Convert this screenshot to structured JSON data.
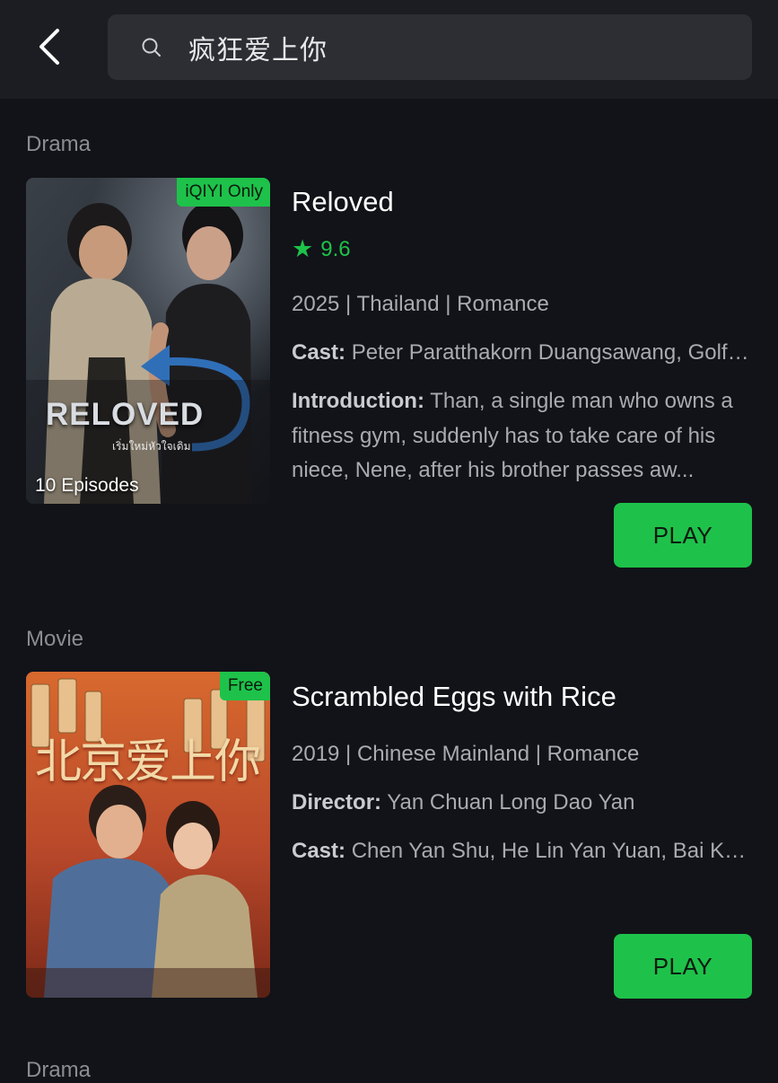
{
  "search": {
    "query": "疯狂爱上你"
  },
  "results": [
    {
      "category": "Drama",
      "badge": "iQIYI Only",
      "episodes": "10 Episodes",
      "poster_text": "RELOVED",
      "poster_subtitle": "เริ่มใหม่หัวใจเดิม",
      "title": "Reloved",
      "rating": "9.6",
      "meta": "2025 | Thailand | Romance",
      "cast_label": "Cast:",
      "cast": "Peter Paratthakorn Duangsawang, Golf K...",
      "intro_label": "Introduction:",
      "intro": "Than, a single man who owns a fitness gym, suddenly has to take care of his niece, Nene, after his brother passes aw...",
      "play_label": "PLAY"
    },
    {
      "category": "Movie",
      "badge": "Free",
      "poster_text": "北京爱上你",
      "title": "Scrambled Eggs with Rice",
      "meta": "2019 | Chinese Mainland | Romance",
      "director_label": "Director:",
      "director": "Yan Chuan Long Dao Yan",
      "cast_label": "Cast:",
      "cast": "Chen Yan Shu, He Lin Yan Yuan, Bai Kaina...",
      "play_label": "PLAY"
    },
    {
      "category": "Drama"
    }
  ],
  "colors": {
    "accent": "#1ec24a",
    "background": "#111318",
    "header": "#1b1d22"
  }
}
